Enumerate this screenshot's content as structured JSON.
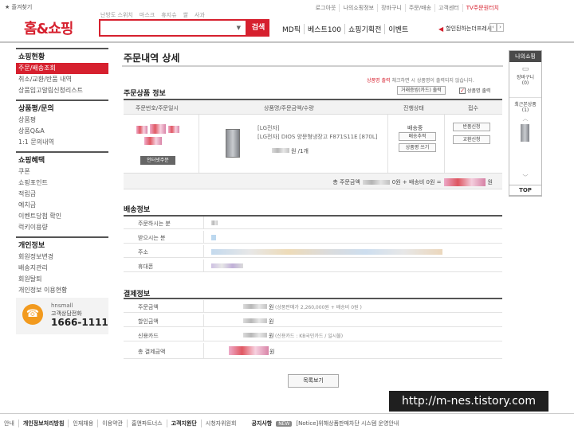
{
  "top_util": {
    "favorites": "즐겨찾기",
    "links": [
      "로그아웃",
      "나의쇼핑정보",
      "장바구니",
      "주문/배송",
      "고객센터",
      "TV주문원터치"
    ]
  },
  "header": {
    "logo": "홈&쇼핑",
    "hot_keywords": [
      "난방도 스위치",
      "마스크",
      "휴지슈",
      "쌀",
      "사과"
    ],
    "search_placeholder": "",
    "search_button": "검색",
    "gnb": [
      "MD픽",
      "베스트100",
      "쇼핑기획전",
      "이벤트"
    ],
    "promo_text": "할인된하는더프레시"
  },
  "left_nav": [
    {
      "title": "쇼핑현황",
      "items": [
        "주문/배송조회",
        "취소/교환/반품 내역",
        "상품입고알림신청리스트"
      ],
      "active_index": 0
    },
    {
      "title": "상품평/문의",
      "items": [
        "상품평",
        "상품Q&A",
        "1:1 문의내역"
      ]
    },
    {
      "title": "쇼핑혜택",
      "items": [
        "쿠폰",
        "쇼핑포인트",
        "적립금",
        "예치금",
        "이벤트당첨 확인",
        "럭키이용량"
      ]
    },
    {
      "title": "개인정보",
      "items": [
        "회원정보변경",
        "배송지관리",
        "회원탈퇴",
        "개인정보 이용현황"
      ]
    }
  ],
  "callcenter": {
    "brand": "hnsmall",
    "label": "고객상담전화",
    "number": "1666-1111"
  },
  "main": {
    "title": "주문내역 상세",
    "notice_red": "상품명 출력",
    "notice_rest": "체크하면 시 상품명이 출력되지 않습니다.",
    "product_section_title": "주문상품 정보",
    "receipt_button": "거래증빙(카드) 출력",
    "print_name_checkbox": "상품명 출력",
    "table_headers": [
      "주문번호/주문일시",
      "상품명/주문금액/수량",
      "진행상태",
      "접수"
    ],
    "member_order_badge": "인터넷주문",
    "product_brand": "[LG전자]",
    "product_name": "[LG전자] DIOS 양문형냉장고 F871S11E [870L]",
    "product_unit": "원 /1개",
    "status": "배송중",
    "status_buttons": [
      "배송추적",
      "상품평 쓰기"
    ],
    "action_buttons": [
      "반품신청",
      "교환신청"
    ],
    "total_prefix": "총 주문금액",
    "total_mid": "0원 + 배송비 0원 =",
    "total_suffix": "원"
  },
  "delivery": {
    "title": "배송정보",
    "rows": [
      "주문하시는 분",
      "받으시는 분",
      "주소",
      "휴대폰"
    ]
  },
  "payment": {
    "title": "결제정보",
    "rows": [
      {
        "label": "주문금액",
        "hint": "(상품판매가 2,260,000원 + 배송비 0원 )"
      },
      {
        "label": "할인금액",
        "hint": ""
      },
      {
        "label": "신용카드",
        "hint": "(신용카드 : KB국민카드 / 일시불)"
      },
      {
        "label": "총 결제금액",
        "hint": ""
      }
    ],
    "won": "원"
  },
  "list_button": "목록보기",
  "footer": {
    "links": [
      "안내",
      "개인정보처리방침",
      "인재채용",
      "이용약관",
      "홈앤파트너스",
      "고객지원단",
      "시청자위원회"
    ],
    "bold_indices": [
      1,
      5
    ],
    "notice_label": "공지사항",
    "new_badge": "NEW",
    "notice_text": "[Notice]위해상품판매차단 시스템 운영안내"
  },
  "watermark": "http://m-nes.tistory.com",
  "right_panel": {
    "title": "나의쇼핑",
    "cart": "장바구니",
    "cart_count": "(0)",
    "recent": "최근본상품",
    "recent_count": "(1)",
    "top": "TOP"
  },
  "colors": {
    "brand": "#d6202e",
    "call_icon": "#f29a1e"
  }
}
